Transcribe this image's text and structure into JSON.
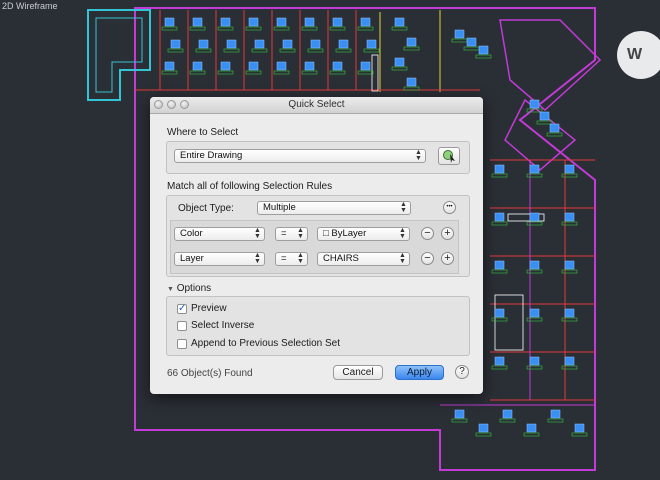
{
  "viewport": {
    "label": "2D Wireframe"
  },
  "viewcube": {
    "label": "W"
  },
  "dialog": {
    "title": "Quick Select",
    "where_label": "Where to Select",
    "where_value": "Entire Drawing",
    "rules_label": "Match all of following Selection Rules",
    "object_type_label": "Object Type:",
    "object_type_value": "Multiple",
    "rules": [
      {
        "property": "Color",
        "operator": "=",
        "value": "□  ByLayer"
      },
      {
        "property": "Layer",
        "operator": "=",
        "value": "CHAIRS"
      }
    ],
    "options_label": "Options",
    "options": [
      {
        "label": "Preview",
        "checked": true
      },
      {
        "label": "Select Inverse",
        "checked": false
      },
      {
        "label": "Append to Previous Selection Set",
        "checked": false
      }
    ],
    "found_text": "66 Object(s) Found",
    "cancel_label": "Cancel",
    "apply_label": "Apply",
    "help_label": "?",
    "ellipsis_label": "•••",
    "minus_label": "−",
    "plus_label": "+",
    "disclosure_label": "▼",
    "check_mark": "✓",
    "arrow_up": "▲",
    "arrow_down": "▼"
  },
  "colors": {
    "canvas": "#2a2e35",
    "wall": "#c23bd6",
    "room": "#e33a3a",
    "furniture": "#3a8ff2",
    "desk": "#ffffff",
    "green": "#36c742",
    "yellow": "#e4d43a",
    "cyan": "#34c4d6"
  }
}
